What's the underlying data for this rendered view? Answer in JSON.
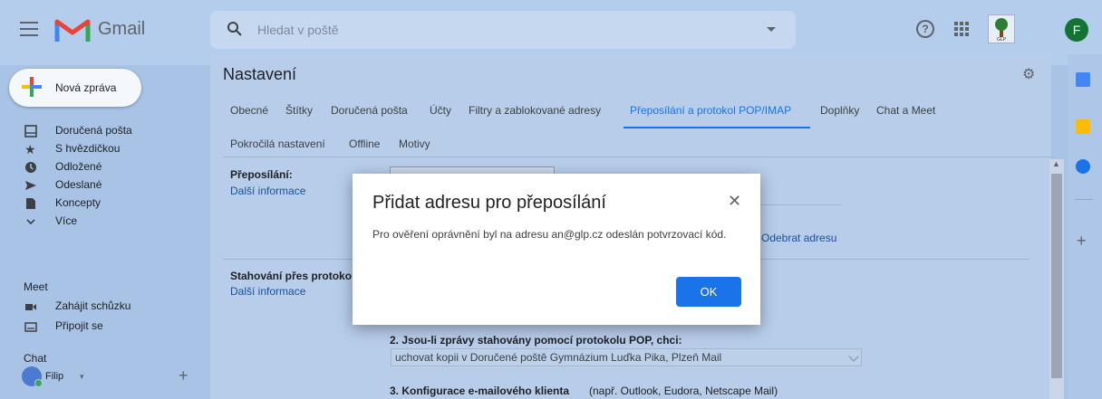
{
  "app": {
    "brand": "Gmail"
  },
  "search": {
    "placeholder": "Hledat v poště"
  },
  "header": {
    "help": "?",
    "avatar_letter": "F"
  },
  "compose": {
    "label": "Nová zpráva"
  },
  "sidebar": {
    "items": [
      {
        "label": "Doručená pošta",
        "icon": "inbox-icon"
      },
      {
        "label": "S hvězdičkou",
        "icon": "star-icon"
      },
      {
        "label": "Odložené",
        "icon": "clock-icon"
      },
      {
        "label": "Odeslané",
        "icon": "send-icon"
      },
      {
        "label": "Koncepty",
        "icon": "draft-icon"
      },
      {
        "label": "Více",
        "icon": "chevron-down-icon"
      }
    ],
    "meet": {
      "title": "Meet",
      "items": [
        {
          "label": "Zahájit schůzku",
          "icon": "video-icon"
        },
        {
          "label": "Připojit se",
          "icon": "keyboard-icon"
        }
      ]
    },
    "chat": {
      "title": "Chat",
      "user": "Filip"
    }
  },
  "settings": {
    "title": "Nastavení",
    "tabs_row1": [
      "Obecné",
      "Štítky",
      "Doručená pošta",
      "Účty",
      "Filtry a zablokované adresy",
      "Přeposílání a protokol POP/IMAP",
      "Doplňky",
      "Chat a Meet"
    ],
    "tabs_row2": [
      "Pokročilá nastavení",
      "Offline",
      "Motivy"
    ],
    "forwarding": {
      "label": "Přeposílání:",
      "link": "Další informace",
      "remove_link": "Odebrat adresu"
    },
    "pop": {
      "label": "Stahování přes protoko",
      "link": "Další informace"
    },
    "pop_step2": {
      "label": "2. Jsou-li zprávy stahovány pomocí protokolu POP, chci:",
      "select_value": "uchovat kopii v Doručené poště Gymnázium Luďka Pika, Plzeň Mail"
    },
    "pop_step3": {
      "label": "3. Konfigurace e-mailového klienta",
      "hint": "(např. Outlook, Eudora, Netscape Mail)"
    }
  },
  "dialog": {
    "title": "Přidat adresu pro přeposílání",
    "body": "Pro ověření oprávnění byl na adresu an@glp.cz odeslán potvrzovací kód.",
    "ok_label": "OK"
  },
  "colors": {
    "accent": "#1a73e8",
    "avatar": "#137333"
  }
}
